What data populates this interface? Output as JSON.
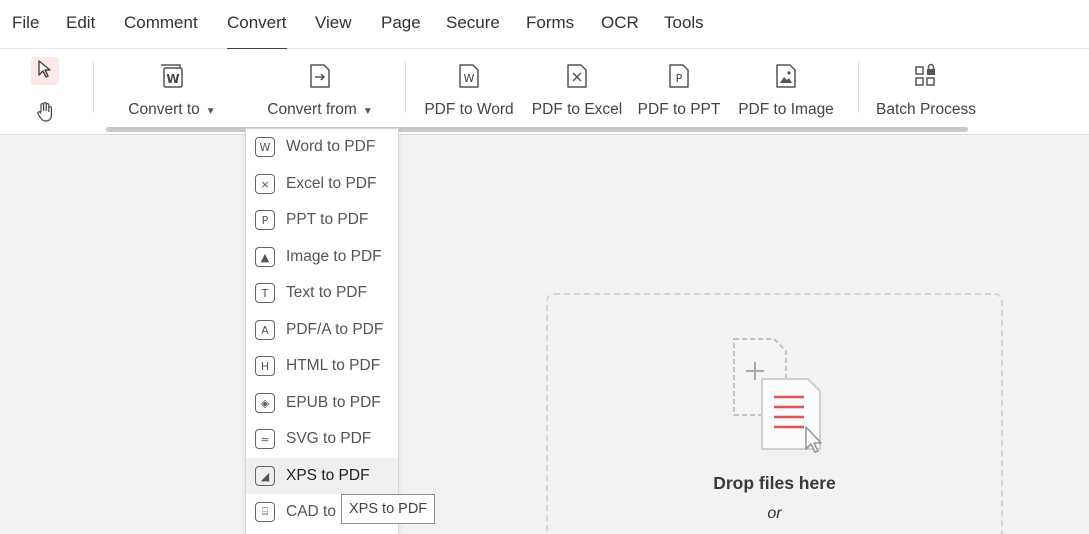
{
  "menu": {
    "items": [
      {
        "label": "File"
      },
      {
        "label": "Edit"
      },
      {
        "label": "Comment"
      },
      {
        "label": "Convert",
        "active": true
      },
      {
        "label": "View"
      },
      {
        "label": "Page"
      },
      {
        "label": "Secure"
      },
      {
        "label": "Forms"
      },
      {
        "label": "OCR"
      },
      {
        "label": "Tools"
      }
    ]
  },
  "ribbon": {
    "convert_to": {
      "label": "Convert to",
      "icon": "word-doc-icon"
    },
    "convert_from": {
      "label": "Convert from",
      "icon": "import-arrow-icon"
    },
    "pdf_to_word": {
      "label": "PDF to Word",
      "icon": "word-icon"
    },
    "pdf_to_excel": {
      "label": "PDF to Excel",
      "icon": "excel-icon"
    },
    "pdf_to_ppt": {
      "label": "PDF to PPT",
      "icon": "ppt-icon"
    },
    "pdf_to_image": {
      "label": "PDF to Image",
      "icon": "image-icon"
    },
    "batch_process": {
      "label": "Batch Process",
      "icon": "batch-grid-lock-icon"
    }
  },
  "tools": {
    "select_icon": "cursor-arrow-icon",
    "hand_icon": "hand-icon"
  },
  "dropdown": {
    "items": [
      {
        "label": "Word to PDF",
        "glyph": "W"
      },
      {
        "label": "Excel to PDF",
        "glyph": "×"
      },
      {
        "label": "PPT to PDF",
        "glyph": "P"
      },
      {
        "label": "Image to PDF",
        "glyph": "▲"
      },
      {
        "label": "Text to PDF",
        "glyph": "T"
      },
      {
        "label": "PDF/A to PDF",
        "glyph": "A"
      },
      {
        "label": "HTML to PDF",
        "glyph": "H"
      },
      {
        "label": "EPUB to PDF",
        "glyph": "◈"
      },
      {
        "label": "SVG to PDF",
        "glyph": "≈"
      },
      {
        "label": "XPS to PDF",
        "glyph": "◢",
        "hover": true
      },
      {
        "label": "CAD to",
        "glyph": "⌸"
      }
    ]
  },
  "tooltip": {
    "text": "XPS to PDF"
  },
  "dropzone": {
    "title": "Drop files here",
    "or": "or"
  },
  "colors": {
    "accent_red": "#e05454",
    "select_bg": "#fde7e7"
  }
}
